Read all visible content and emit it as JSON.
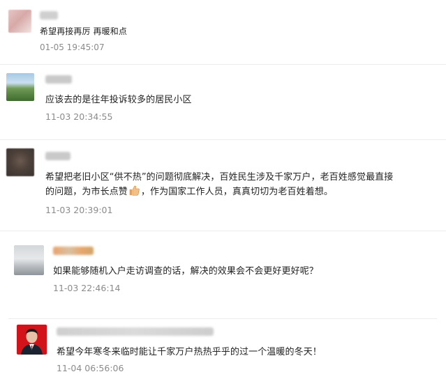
{
  "comments": [
    {
      "text": "希望再接再厉 再暖和点",
      "time": "01-05 19:45:07"
    },
    {
      "text": "应该去的是往年投诉较多的居民小区",
      "time": "11-03 20:34:55"
    },
    {
      "text_line1": "希望把老旧小区“供不热”的问题彻底解决，百姓民生涉及千家万户，老百姓感觉最直接",
      "text_line2a": "的问题，为市长点赞",
      "text_line2b": "，作为国家工作人员，真真切切为老百姓着想。",
      "emoji": "thumbs-up-emoji",
      "time": "11-03 20:39:01"
    },
    {
      "text": "如果能够随机入户走访调查的话，解决的效果会不会更好更好呢？",
      "time": "11-03 22:46:14"
    },
    {
      "text": "希望今年寒冬来临时能让千家万户热热乎乎的过一个温暖的冬天！",
      "time": "11-04 06:56:06"
    }
  ],
  "colors": {
    "divider": "#ececec",
    "time_text": "#8b8b8b",
    "body_text": "#222222"
  }
}
